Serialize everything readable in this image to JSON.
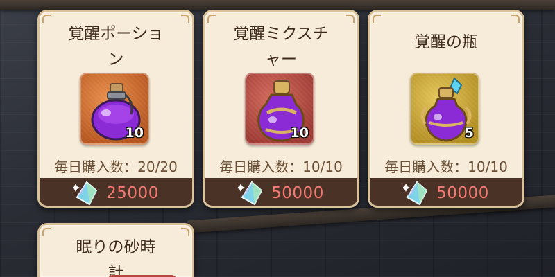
{
  "shop": {
    "items": [
      {
        "name_line1": "覚醒ポーショ",
        "name_line2": "ン",
        "icon": "purple-potion-round-bottle-icon",
        "tile_color": "#c8672b",
        "quantity": "10",
        "purchase_limit": "毎日購入数：20/20",
        "currency_icon": "crystal-gem-icon",
        "price": "25000"
      },
      {
        "name_line1": "覚醒ミクスチ",
        "name_line2": "ャー",
        "icon": "purple-mixture-gold-bottle-icon",
        "tile_color": "#b5473f",
        "quantity": "10",
        "purchase_limit": "毎日購入数：10/10",
        "currency_icon": "crystal-gem-icon",
        "price": "50000"
      },
      {
        "name_line1": "覚醒の瓶",
        "name_line2": "",
        "icon": "purple-flask-blue-gem-icon",
        "tile_color": "#cfae3a",
        "quantity": "5",
        "purchase_limit": "毎日購入数：10/10",
        "currency_icon": "crystal-gem-icon",
        "price": "50000"
      },
      {
        "name_line1": "眠りの砂時",
        "name_line2": "計"
      }
    ]
  }
}
